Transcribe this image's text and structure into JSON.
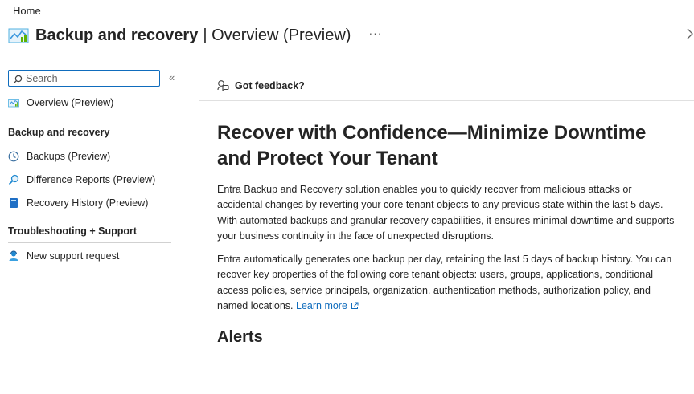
{
  "breadcrumb": {
    "home": "Home"
  },
  "header": {
    "title_strong": "Backup and recovery",
    "title_rest": "| Overview (Preview)",
    "more": "···",
    "icon": "backup-chart-icon"
  },
  "sidebar": {
    "search_placeholder": "Search",
    "collapse": "«",
    "overview": "Overview (Preview)",
    "section1": "Backup and recovery",
    "items": [
      {
        "label": "Backups (Preview)",
        "icon": "clock-icon"
      },
      {
        "label": "Difference Reports (Preview)",
        "icon": "search-report-icon"
      },
      {
        "label": "Recovery History (Preview)",
        "icon": "book-icon"
      }
    ],
    "section2": "Troubleshooting + Support",
    "support": {
      "label": "New support request",
      "icon": "person-support-icon"
    }
  },
  "main": {
    "feedback": "Got feedback?",
    "hero_title": "Recover with Confidence—Minimize Downtime and Protect Your Tenant",
    "para1": "Entra Backup and Recovery solution enables you to quickly recover from malicious attacks or accidental changes by reverting your core tenant objects to any previous state within the last 5 days. With automated backups and granular recovery capabilities, it ensures minimal downtime and supports your business continuity in the face of unexpected disruptions.",
    "para2": "Entra automatically generates one backup per day, retaining the last 5 days of backup history. You can recover key properties of the following core tenant objects: users, groups, applications, conditional access policies, service principals, organization, authentication methods, authorization policy, and named locations.",
    "learn_more": "Learn more",
    "alerts": "Alerts"
  },
  "colors": {
    "accent": "#0f6cbd",
    "text": "#242424"
  }
}
